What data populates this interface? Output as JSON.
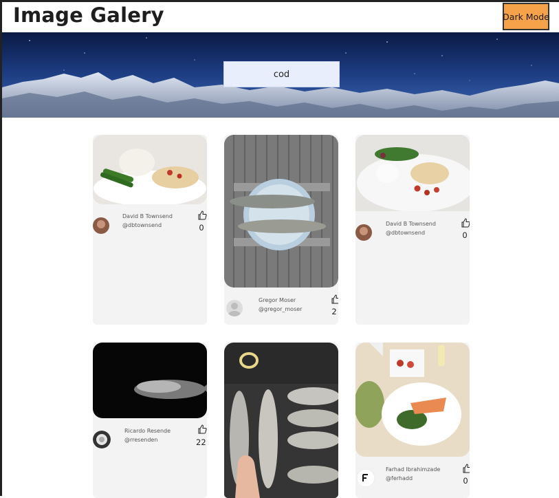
{
  "header": {
    "title": "Image Galery",
    "dark_mode_label": "Dark Mode"
  },
  "search": {
    "value": "cod"
  },
  "colors": {
    "accent_button": "#f6a24b",
    "card_bg": "#f3f3f3",
    "search_bg": "#e8eefb"
  },
  "cards": [
    {
      "name": "David B Townsend",
      "handle": "@dbtownsend",
      "likes": "0"
    },
    {
      "name": "Gregor Moser",
      "handle": "@gregor_moser",
      "likes": "2"
    },
    {
      "name": "David B Townsend",
      "handle": "@dbtownsend",
      "likes": "0"
    },
    {
      "name": "Ricardo Resende",
      "handle": "@rresenden",
      "likes": "22"
    },
    {
      "name": "",
      "handle": "",
      "likes": ""
    },
    {
      "name": "Farhad Ibrahimzade",
      "handle": "@ferhadd",
      "likes": "0"
    }
  ]
}
